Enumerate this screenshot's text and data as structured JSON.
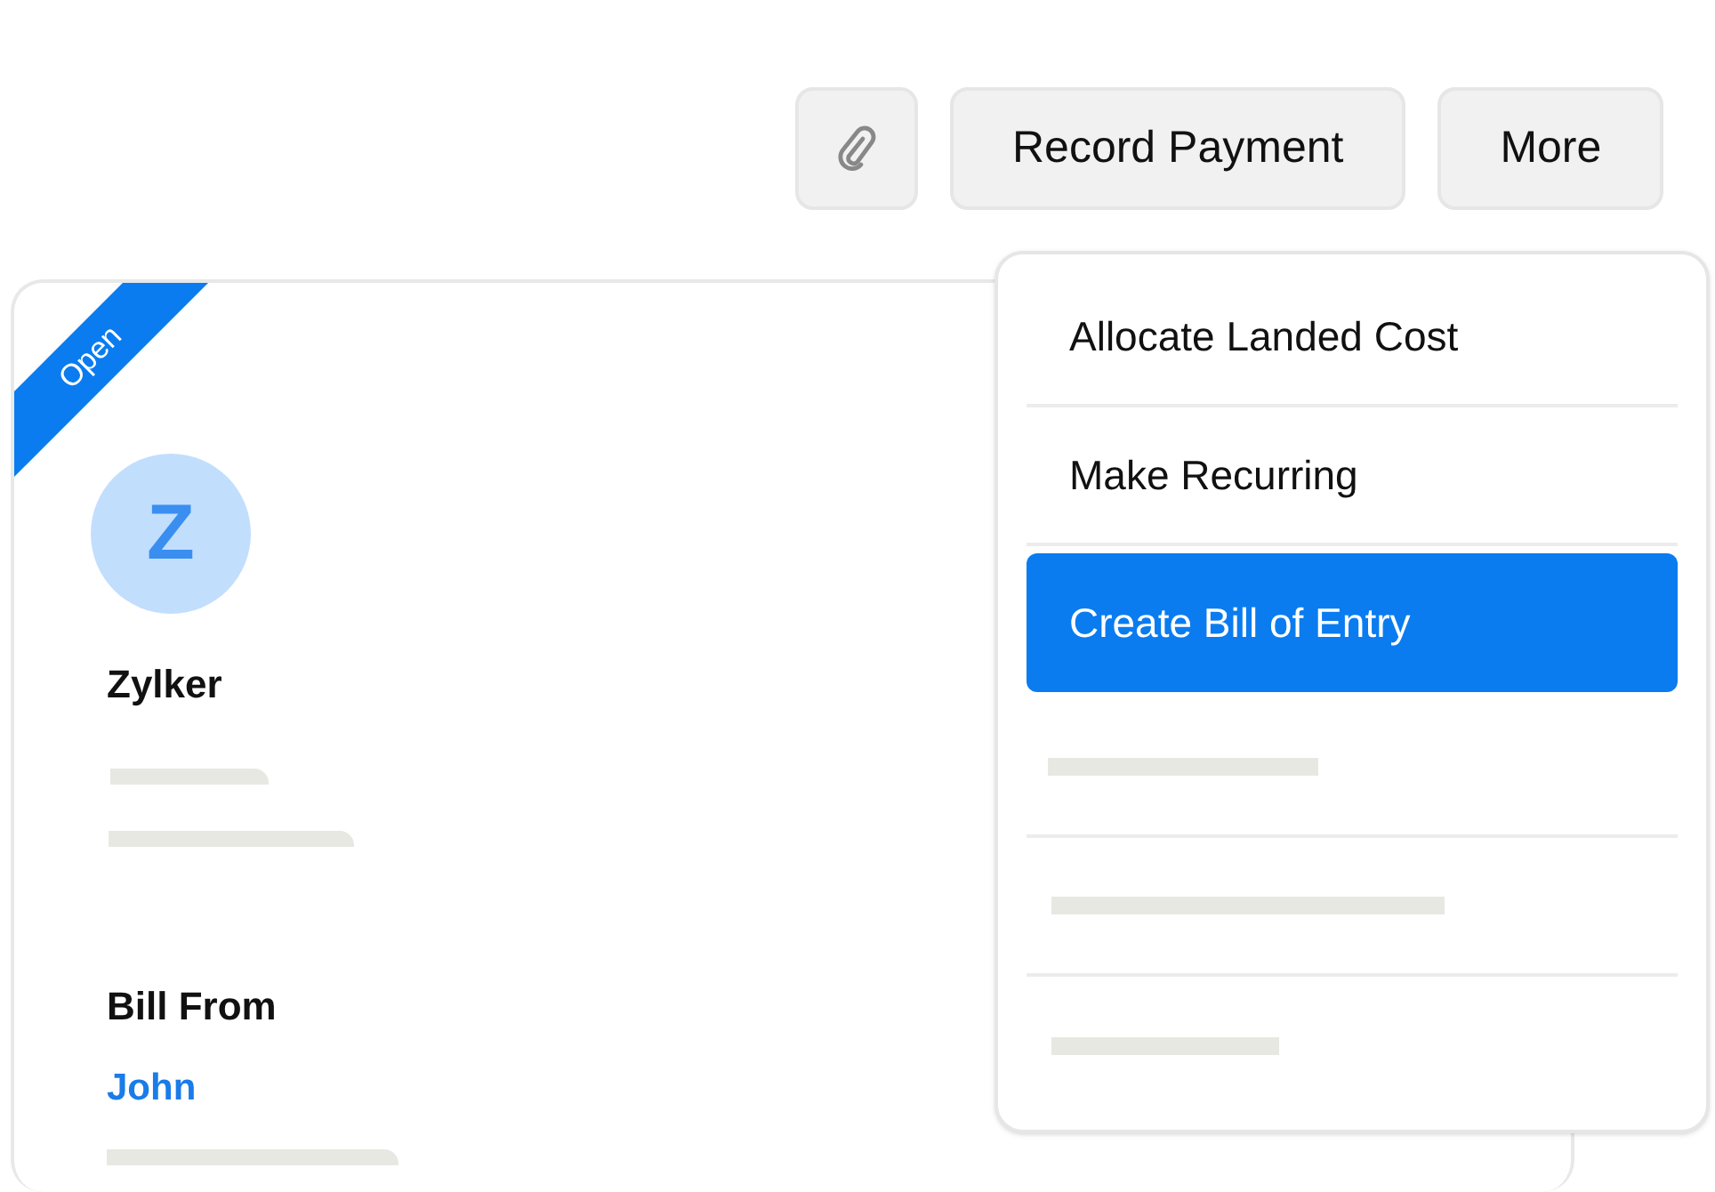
{
  "toolbar": {
    "buttons": [
      {
        "kind": "icon"
      },
      {
        "kind": "text",
        "label": "Record Payment"
      },
      {
        "kind": "text",
        "label": "More"
      }
    ]
  },
  "bill": {
    "status": "Open",
    "avatar_letter": "Z",
    "vendor": "Zylker",
    "section_label": "Bill From",
    "contact": "John"
  },
  "more_menu": {
    "items": [
      {
        "kind": "option",
        "label": "Allocate Landed Cost",
        "selected": false
      },
      {
        "kind": "option",
        "label": "Make Recurring",
        "selected": false
      },
      {
        "kind": "option",
        "label": "Create Bill of Entry",
        "selected": true
      },
      {
        "kind": "skeleton"
      },
      {
        "kind": "skeleton"
      },
      {
        "kind": "skeleton"
      }
    ]
  }
}
